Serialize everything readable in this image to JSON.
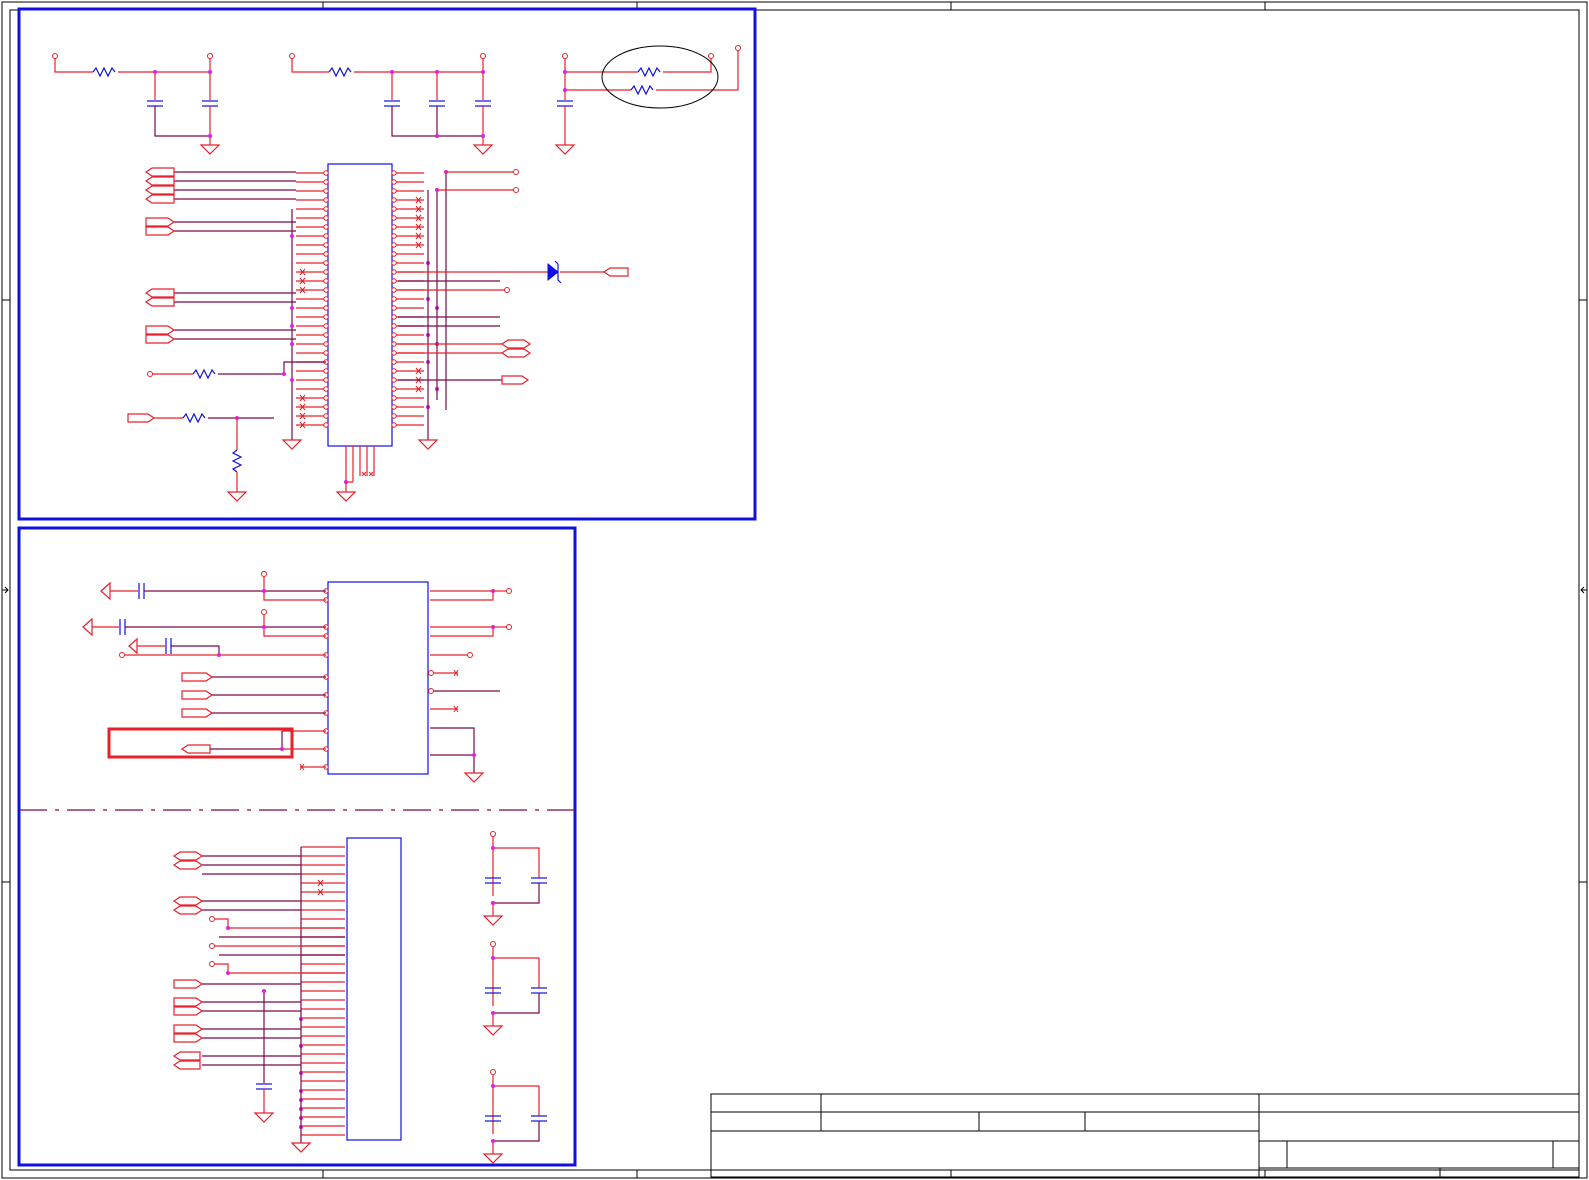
{
  "sheet": {
    "frame_color": "#000000",
    "block_color": "#1010e0",
    "wire_color": "#e8202a",
    "net_color": "#7a0a4a",
    "junction_color": "#e020e0",
    "highlight_color": "#e8202a"
  },
  "blocks": [
    {
      "id": "top-block",
      "components": [
        "resistor-icon",
        "capacitor-icon",
        "ground-icon",
        "ic-chip",
        "diode-icon",
        "port-icon"
      ]
    },
    {
      "id": "bottom-block",
      "components": [
        "capacitor-icon",
        "ic-chip",
        "ground-icon",
        "port-icon",
        "highlight-box"
      ]
    }
  ],
  "title_block": {
    "rows": 3
  }
}
